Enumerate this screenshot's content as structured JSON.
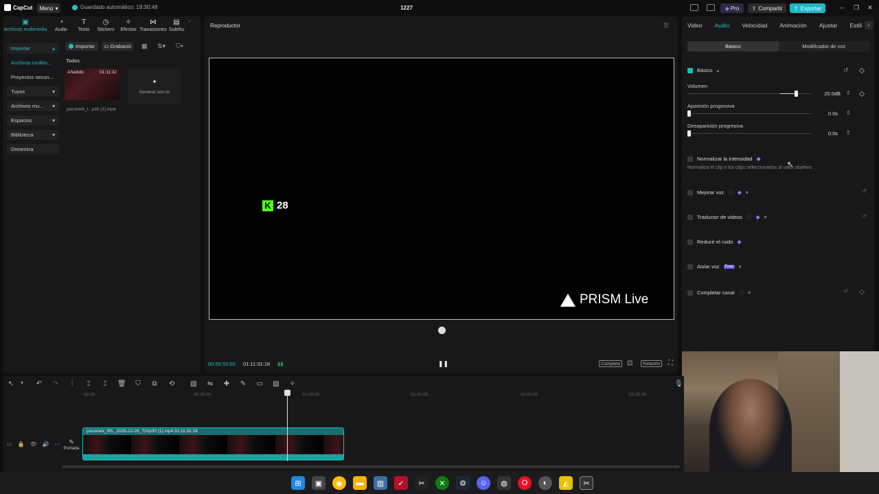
{
  "titlebar": {
    "app_name": "CapCut",
    "menu_label": "Menú",
    "autosave": "Guardado automático: 19:30:48",
    "project_title": "1227",
    "pro_label": "Pro",
    "share_label": "Compartir",
    "export_label": "Exportar"
  },
  "media_tabs": [
    {
      "label": "Archivos multimedia",
      "icon": "media-icon",
      "active": true
    },
    {
      "label": "Audio",
      "icon": "audio-icon"
    },
    {
      "label": "Texto",
      "icon": "text-icon"
    },
    {
      "label": "Stickers",
      "icon": "sticker-icon"
    },
    {
      "label": "Efectos",
      "icon": "effects-icon"
    },
    {
      "label": "Transiciones",
      "icon": "transitions-icon"
    },
    {
      "label": "Subtítu",
      "icon": "subtitles-icon"
    }
  ],
  "side_nav": [
    {
      "label": "Importar",
      "type": "head"
    },
    {
      "label": "Archivos multim...",
      "type": "selected"
    },
    {
      "label": "Proyectos secun...",
      "type": "plain"
    },
    {
      "label": "Tuyos",
      "type": "group"
    },
    {
      "label": "Archivos mu...",
      "type": "group"
    },
    {
      "label": "Espacios",
      "type": "group"
    },
    {
      "label": "Biblioteca",
      "type": "group"
    },
    {
      "label": "Dreamina",
      "type": "item"
    }
  ],
  "media": {
    "import_label": "Importar",
    "record_label": "Grabació",
    "filter_label": "Todos",
    "clip_tag": "Añadido",
    "clip_duration": "01:11:32",
    "clip_name": "pocorielx_l...p30 (1).mp4",
    "generate_ai": "Generar con IA"
  },
  "player": {
    "title": "Reproductor",
    "overlay_number": "28",
    "watermark": "PRISM Live",
    "current_time": "00:55:53:00",
    "total_time": "01:11:31:18",
    "full_label": "Completa",
    "ratio_label": "Relación"
  },
  "right_tabs": [
    "Video",
    "Audio",
    "Velocidad",
    "Animación",
    "Ajustar",
    "Estili"
  ],
  "right_active_tab": 1,
  "sub_tabs": [
    "Básico",
    "Modificador de voz"
  ],
  "audio": {
    "basic_label": "Básico",
    "volume_label": "Volumen",
    "volume_value": "20.0dB",
    "volume_fraction": 0.88,
    "fade_in_label": "Aparición progresiva",
    "fade_in_value": "0.0s",
    "fade_out_label": "Desaparición progresiva",
    "fade_out_value": "0.0s",
    "normalize_label": "Normalizar la intensidad",
    "normalize_help": "Normaliza el clip o los clips seleccionados al valor objetivo.",
    "enhance_voice": "Mejorar voz",
    "video_translator": "Traductor de videos",
    "reduce_noise": "Reducir el ruido",
    "isolate_voice": "Aislar voz",
    "free_badge": "Free",
    "complete_channel": "Completar canal"
  },
  "timeline": {
    "ruler": [
      "00:00",
      "00:30:00",
      "01:00:00",
      "01:30:00",
      "02:00:00",
      "02:30:00"
    ],
    "clip_label": "pocorielx_IRL_2025-12-26_720p30 (1).mp4   01:11:31:18",
    "cover_label": "Portada"
  },
  "colors": {
    "accent": "#1ec0c0",
    "export": "#1fb7c7",
    "kick": "#53fc18"
  }
}
